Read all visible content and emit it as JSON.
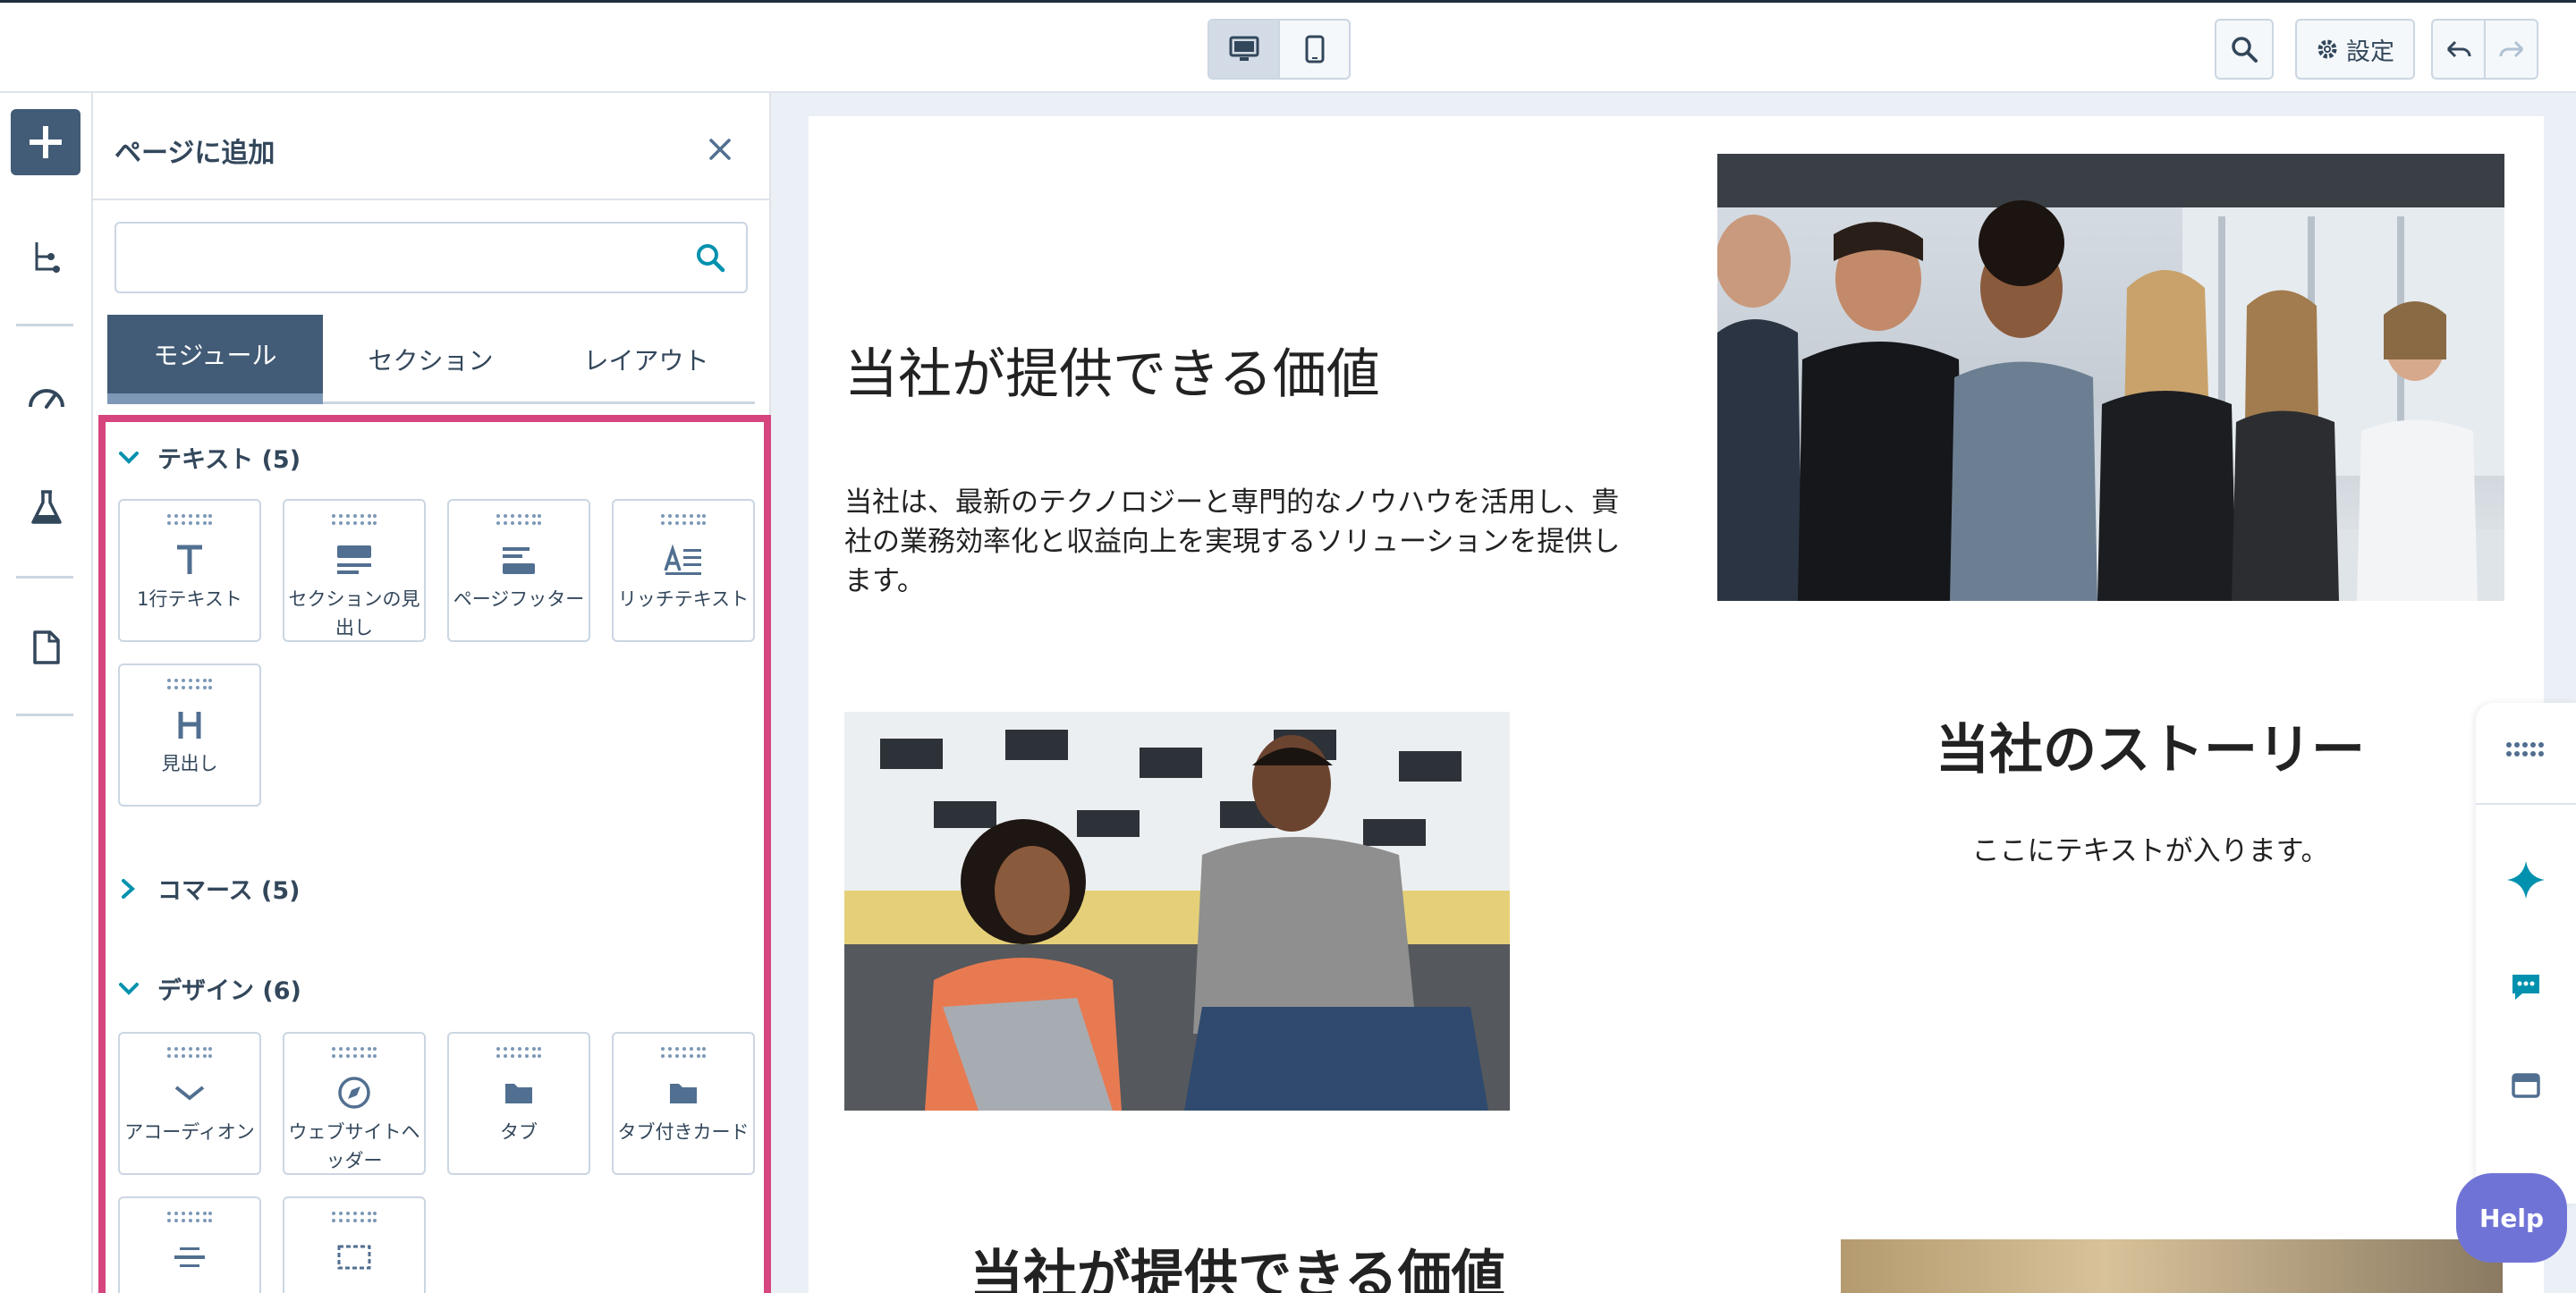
{
  "topbar": {
    "device_desktop": "desktop-icon",
    "device_mobile": "mobile-icon",
    "settings_label": "設定"
  },
  "panel": {
    "title": "ページに追加",
    "search_placeholder": "",
    "tabs": [
      {
        "label": "モジュール",
        "active": true
      },
      {
        "label": "セクション",
        "active": false
      },
      {
        "label": "レイアウト",
        "active": false
      }
    ],
    "categories": {
      "text": {
        "label": "テキスト (5)",
        "expanded": true
      },
      "commerce": {
        "label": "コマース (5)",
        "expanded": false
      },
      "design": {
        "label": "デザイン (6)",
        "expanded": true
      }
    },
    "text_modules": [
      {
        "label": "1行テキスト",
        "icon": "text-icon"
      },
      {
        "label": "セクションの見出し",
        "icon": "section-header-icon"
      },
      {
        "label": "ページフッター",
        "icon": "page-footer-icon"
      },
      {
        "label": "リッチテキスト",
        "icon": "rich-text-icon"
      },
      {
        "label": "見出し",
        "icon": "heading-icon"
      }
    ],
    "design_modules": [
      {
        "label": "アコーディオン",
        "icon": "chevron-down-icon"
      },
      {
        "label": "ウェブサイトヘッダー",
        "icon": "compass-icon"
      },
      {
        "label": "タブ",
        "icon": "folder-icon"
      },
      {
        "label": "タブ付きカード",
        "icon": "folder-icon"
      }
    ]
  },
  "content": {
    "heading_value": "当社が提供できる価値",
    "paragraph_value": "当社は、最新のテクノロジーと専門的なノウハウを活用し、貴社の業務効率化と収益向上を実現するソリューションを提供します。",
    "heading_story": "当社のストーリー",
    "paragraph_story": "ここにテキストが入ります。",
    "heading_value_2": "当社が提供できる価値"
  },
  "help_label": "Help",
  "colors": {
    "accent": "#425b76",
    "highlight": "#d6457d",
    "help": "#7073d6",
    "link": "#0091ae"
  }
}
